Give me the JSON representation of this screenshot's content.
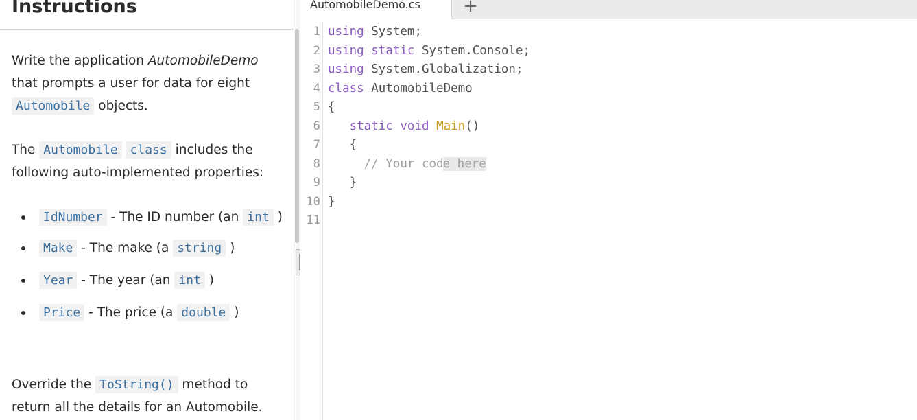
{
  "instructions": {
    "title": "Instructions",
    "para1": {
      "t1": "Write the application ",
      "t2": "AutomobileDemo",
      "t3": " that prompts a user for data for eight ",
      "code1": "Automobile",
      "t4": " objects."
    },
    "para2": {
      "t1": "The ",
      "code1": "Automobile",
      "t2": " ",
      "code2": "class",
      "t3": " includes the following auto-implemented properties:"
    },
    "bullets": [
      {
        "code": "IdNumber",
        "text": " - The ID number (an ",
        "type": "int",
        "close": " )"
      },
      {
        "code": "Make",
        "text": " - The make (a ",
        "type": "string",
        "close": " )"
      },
      {
        "code": "Year",
        "text": " - The year (an ",
        "type": "int",
        "close": " )"
      },
      {
        "code": "Price",
        "text": " - The price (a ",
        "type": "double",
        "close": " )"
      }
    ],
    "para3": {
      "t1": "Override the ",
      "code1": "ToString()",
      "t2": " method to return all the details for an Automobile."
    }
  },
  "editor": {
    "tab_label": "AutomobileDemo.cs",
    "add_tab": "+",
    "line_numbers": [
      "1",
      "2",
      "3",
      "4",
      "5",
      "6",
      "7",
      "8",
      "9",
      "10",
      "11"
    ],
    "code": {
      "l1_kw": "using",
      "l1_rest": " System;",
      "l2_kw": "using",
      "l2_kw2": "static",
      "l2_rest": " System.Console;",
      "l3_kw": "using",
      "l3_rest": " System.Globalization;",
      "l4_kw": "class",
      "l4_rest": " AutomobileDemo",
      "l5": "{",
      "l6_kw": "static",
      "l6_kw2": "void",
      "l6_fn": "Main",
      "l6_rest": "()",
      "l7": "{",
      "l8_a": "// Your cod",
      "l8_b": "e here",
      "l9": "}",
      "l10": "}"
    }
  }
}
